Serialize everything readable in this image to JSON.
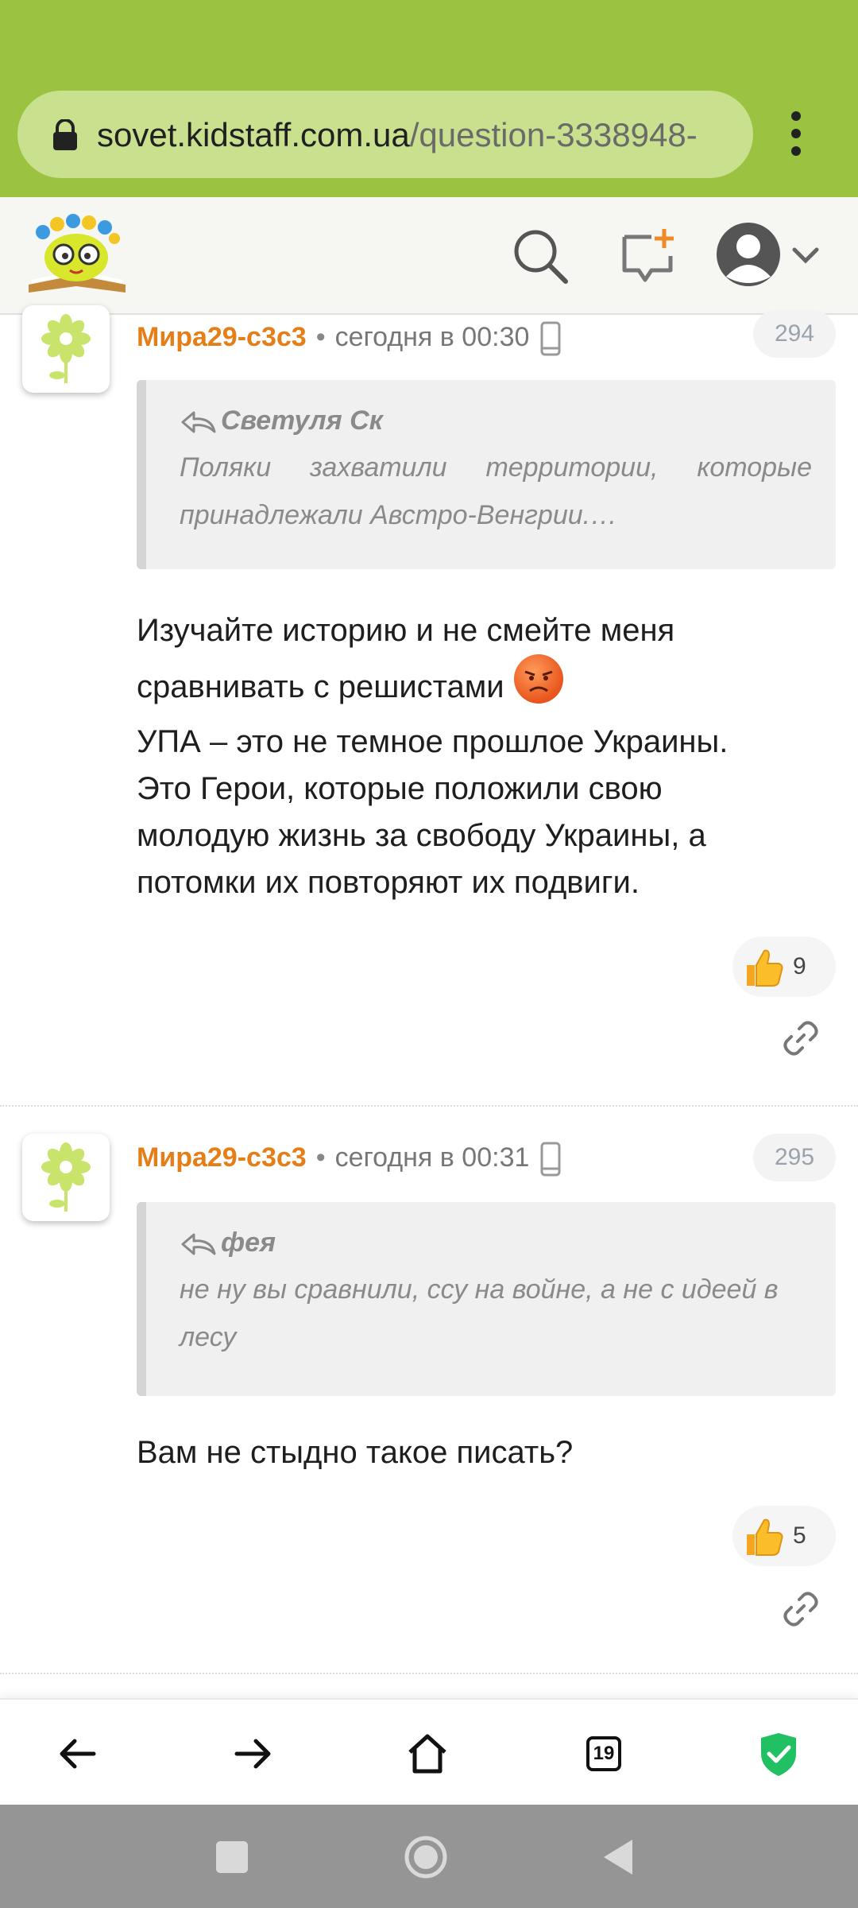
{
  "browser": {
    "url_host": "sovet.kidstaff.com.ua",
    "url_path": "/question-3338948-",
    "tabs_count": "19",
    "accent": "#9bc241"
  },
  "header": {
    "logo_icon": "kidstaff-logo",
    "search_icon": "search-icon",
    "compose_icon": "new-question-icon",
    "avatar_icon": "user-avatar"
  },
  "comments": [
    {
      "author": "Мира29-с3с3",
      "time": "сегодня в 00:30",
      "number": "294",
      "quote_author": "Светуля Ск",
      "quote_text": "Поляки захватили территории, которые принадлежали Австро-Венгрии.…",
      "body_lines": [
        "Изучайте историю и не смейте меня",
        "сравнивать с решистами",
        "УПА – это не темное прошлое Украины.",
        "Это Герои, которые положили свою",
        "молодую жизнь за свободу Украины, а",
        "потомки их повторяют их подвиги."
      ],
      "likes": "9"
    },
    {
      "author": "Мира29-с3с3",
      "time": "сегодня в 00:31",
      "number": "295",
      "quote_author": "фея",
      "quote_text": "не ну вы сравнили, ссу на войне, а не с идеей в лесу",
      "body_lines": [
        "Вам не стыдно такое писать?"
      ],
      "likes": "5"
    }
  ]
}
